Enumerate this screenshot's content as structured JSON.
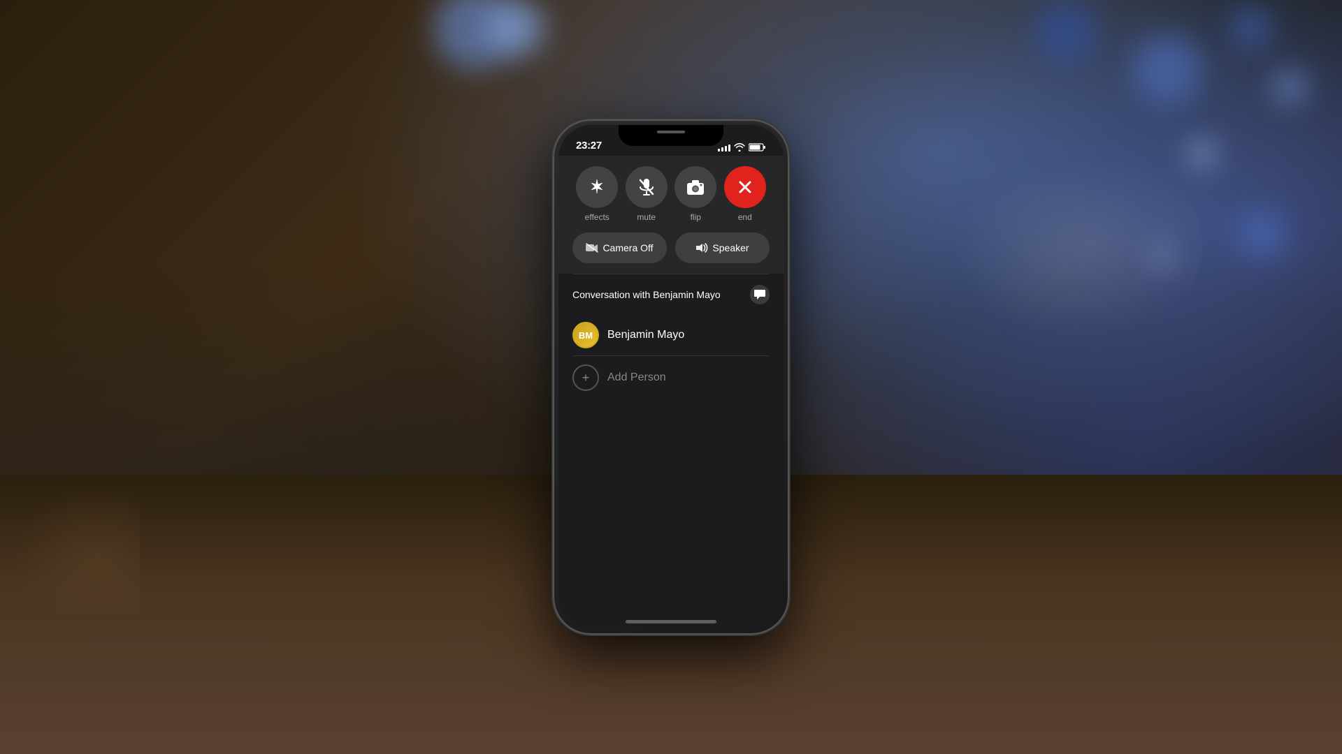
{
  "background": {
    "bokeh_color": "#6a8fd8"
  },
  "status_bar": {
    "time": "23:27",
    "arrow": "↑"
  },
  "call_controls": {
    "buttons": [
      {
        "id": "effects",
        "icon": "✦",
        "label": "effects",
        "color": "gray"
      },
      {
        "id": "mute",
        "icon": "🎤",
        "label": "mute",
        "color": "gray"
      },
      {
        "id": "flip",
        "icon": "📷",
        "label": "flip",
        "color": "gray"
      },
      {
        "id": "end",
        "icon": "✕",
        "label": "end",
        "color": "red"
      }
    ],
    "wide_buttons": [
      {
        "id": "camera-off",
        "icon": "📷",
        "label": "Camera Off"
      },
      {
        "id": "speaker",
        "icon": "🔊",
        "label": "Speaker"
      }
    ]
  },
  "conversation": {
    "title": "Conversation with Benjamin Mayo",
    "message_icon": "💬",
    "participants": [
      {
        "initials": "BM",
        "name": "Benjamin Mayo",
        "avatar_color": "#c8a020"
      }
    ],
    "add_person_label": "Add Person"
  }
}
